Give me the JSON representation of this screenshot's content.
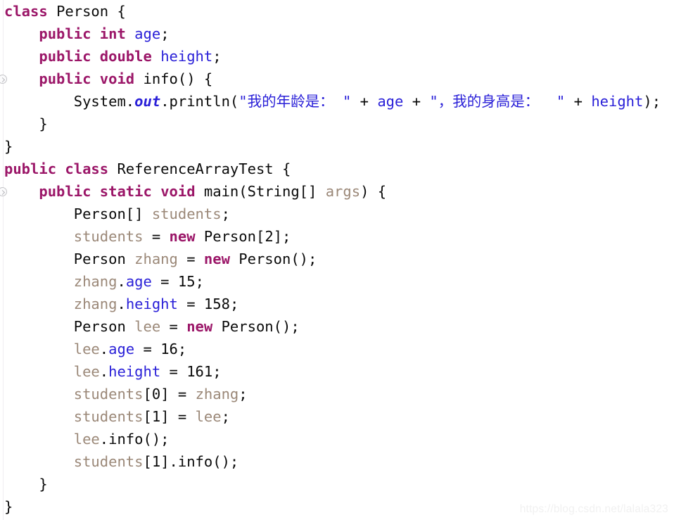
{
  "editor": {
    "background_color": "#ffffff",
    "watermark": "https://blog.csdn.net/lalala323",
    "colors": {
      "keyword": "#9B1668",
      "field": "#2a20d8",
      "string": "#2a20d8",
      "local_variable": "#9b8878",
      "plain_text": "#0a0a0a",
      "watermark": "#f1f1f1",
      "gutter_icon_border": "#c2c2c6"
    },
    "gutter_markers": [
      {
        "name": "implemented-method-marker",
        "line_index": 3
      },
      {
        "name": "run-main-marker",
        "line_index": 8
      }
    ]
  },
  "code": {
    "language": "Java",
    "lines": [
      {
        "indent": 0,
        "tokens": [
          {
            "t": "class",
            "k": "keyword"
          },
          {
            "t": " ",
            "k": "plain"
          },
          {
            "t": "Person",
            "k": "type"
          },
          {
            "t": " {",
            "k": "plain"
          }
        ]
      },
      {
        "indent": 1,
        "tokens": [
          {
            "t": "public",
            "k": "keyword"
          },
          {
            "t": " ",
            "k": "plain"
          },
          {
            "t": "int",
            "k": "keyword"
          },
          {
            "t": " ",
            "k": "plain"
          },
          {
            "t": "age",
            "k": "field"
          },
          {
            "t": ";",
            "k": "plain"
          }
        ]
      },
      {
        "indent": 1,
        "tokens": [
          {
            "t": "public",
            "k": "keyword"
          },
          {
            "t": " ",
            "k": "plain"
          },
          {
            "t": "double",
            "k": "keyword"
          },
          {
            "t": " ",
            "k": "plain"
          },
          {
            "t": "height",
            "k": "field"
          },
          {
            "t": ";",
            "k": "plain"
          }
        ]
      },
      {
        "indent": 1,
        "tokens": [
          {
            "t": "public",
            "k": "keyword"
          },
          {
            "t": " ",
            "k": "plain"
          },
          {
            "t": "void",
            "k": "keyword"
          },
          {
            "t": " ",
            "k": "plain"
          },
          {
            "t": "info",
            "k": "method"
          },
          {
            "t": "() {",
            "k": "plain"
          }
        ]
      },
      {
        "indent": 2,
        "tokens": [
          {
            "t": "System.",
            "k": "plain"
          },
          {
            "t": "out",
            "k": "static"
          },
          {
            "t": ".println(",
            "k": "plain"
          },
          {
            "t": "\"我的年龄是： \"",
            "k": "string"
          },
          {
            "t": " + ",
            "k": "plain"
          },
          {
            "t": "age",
            "k": "field"
          },
          {
            "t": " + ",
            "k": "plain"
          },
          {
            "t": "\"，我的身高是：  \"",
            "k": "string"
          },
          {
            "t": " + ",
            "k": "plain"
          },
          {
            "t": "height",
            "k": "field"
          },
          {
            "t": ");",
            "k": "plain"
          }
        ]
      },
      {
        "indent": 1,
        "tokens": [
          {
            "t": "}",
            "k": "plain"
          }
        ]
      },
      {
        "indent": 0,
        "tokens": [
          {
            "t": "}",
            "k": "plain"
          }
        ]
      },
      {
        "indent": 0,
        "tokens": [
          {
            "t": "public",
            "k": "keyword"
          },
          {
            "t": " ",
            "k": "plain"
          },
          {
            "t": "class",
            "k": "keyword"
          },
          {
            "t": " ",
            "k": "plain"
          },
          {
            "t": "ReferenceArrayTest",
            "k": "type"
          },
          {
            "t": " {",
            "k": "plain"
          }
        ]
      },
      {
        "indent": 1,
        "tokens": [
          {
            "t": "public",
            "k": "keyword"
          },
          {
            "t": " ",
            "k": "plain"
          },
          {
            "t": "static",
            "k": "keyword"
          },
          {
            "t": " ",
            "k": "plain"
          },
          {
            "t": "void",
            "k": "keyword"
          },
          {
            "t": " ",
            "k": "plain"
          },
          {
            "t": "main",
            "k": "method"
          },
          {
            "t": "(String[] ",
            "k": "plain"
          },
          {
            "t": "args",
            "k": "param"
          },
          {
            "t": ") {",
            "k": "plain"
          }
        ]
      },
      {
        "indent": 2,
        "tokens": [
          {
            "t": "Person[] ",
            "k": "plain"
          },
          {
            "t": "students",
            "k": "local"
          },
          {
            "t": ";",
            "k": "plain"
          }
        ]
      },
      {
        "indent": 2,
        "tokens": [
          {
            "t": "students",
            "k": "local"
          },
          {
            "t": " = ",
            "k": "plain"
          },
          {
            "t": "new",
            "k": "keyword"
          },
          {
            "t": " Person[",
            "k": "plain"
          },
          {
            "t": "2",
            "k": "number"
          },
          {
            "t": "];",
            "k": "plain"
          }
        ]
      },
      {
        "indent": 2,
        "tokens": [
          {
            "t": "Person ",
            "k": "plain"
          },
          {
            "t": "zhang",
            "k": "local"
          },
          {
            "t": " = ",
            "k": "plain"
          },
          {
            "t": "new",
            "k": "keyword"
          },
          {
            "t": " Person();",
            "k": "plain"
          }
        ]
      },
      {
        "indent": 2,
        "tokens": [
          {
            "t": "zhang",
            "k": "local"
          },
          {
            "t": ".",
            "k": "plain"
          },
          {
            "t": "age",
            "k": "field"
          },
          {
            "t": " = ",
            "k": "plain"
          },
          {
            "t": "15",
            "k": "number"
          },
          {
            "t": ";",
            "k": "plain"
          }
        ]
      },
      {
        "indent": 2,
        "tokens": [
          {
            "t": "zhang",
            "k": "local"
          },
          {
            "t": ".",
            "k": "plain"
          },
          {
            "t": "height",
            "k": "field"
          },
          {
            "t": " = ",
            "k": "plain"
          },
          {
            "t": "158",
            "k": "number"
          },
          {
            "t": ";",
            "k": "plain"
          }
        ]
      },
      {
        "indent": 2,
        "tokens": [
          {
            "t": "Person ",
            "k": "plain"
          },
          {
            "t": "lee",
            "k": "local"
          },
          {
            "t": " = ",
            "k": "plain"
          },
          {
            "t": "new",
            "k": "keyword"
          },
          {
            "t": " Person();",
            "k": "plain"
          }
        ]
      },
      {
        "indent": 2,
        "tokens": [
          {
            "t": "lee",
            "k": "local"
          },
          {
            "t": ".",
            "k": "plain"
          },
          {
            "t": "age",
            "k": "field"
          },
          {
            "t": " = ",
            "k": "plain"
          },
          {
            "t": "16",
            "k": "number"
          },
          {
            "t": ";",
            "k": "plain"
          }
        ]
      },
      {
        "indent": 2,
        "tokens": [
          {
            "t": "lee",
            "k": "local"
          },
          {
            "t": ".",
            "k": "plain"
          },
          {
            "t": "height",
            "k": "field"
          },
          {
            "t": " = ",
            "k": "plain"
          },
          {
            "t": "161",
            "k": "number"
          },
          {
            "t": ";",
            "k": "plain"
          }
        ]
      },
      {
        "indent": 2,
        "tokens": [
          {
            "t": "students",
            "k": "local"
          },
          {
            "t": "[",
            "k": "plain"
          },
          {
            "t": "0",
            "k": "number"
          },
          {
            "t": "] = ",
            "k": "plain"
          },
          {
            "t": "zhang",
            "k": "local"
          },
          {
            "t": ";",
            "k": "plain"
          }
        ]
      },
      {
        "indent": 2,
        "tokens": [
          {
            "t": "students",
            "k": "local"
          },
          {
            "t": "[",
            "k": "plain"
          },
          {
            "t": "1",
            "k": "number"
          },
          {
            "t": "] = ",
            "k": "plain"
          },
          {
            "t": "lee",
            "k": "local"
          },
          {
            "t": ";",
            "k": "plain"
          }
        ]
      },
      {
        "indent": 2,
        "tokens": [
          {
            "t": "lee",
            "k": "local"
          },
          {
            "t": ".info();",
            "k": "plain"
          }
        ]
      },
      {
        "indent": 2,
        "tokens": [
          {
            "t": "students",
            "k": "local"
          },
          {
            "t": "[",
            "k": "plain"
          },
          {
            "t": "1",
            "k": "number"
          },
          {
            "t": "].info();",
            "k": "plain"
          }
        ]
      },
      {
        "indent": 1,
        "tokens": [
          {
            "t": "}",
            "k": "plain"
          }
        ]
      },
      {
        "indent": 0,
        "tokens": [
          {
            "t": "}",
            "k": "plain"
          }
        ]
      }
    ]
  }
}
